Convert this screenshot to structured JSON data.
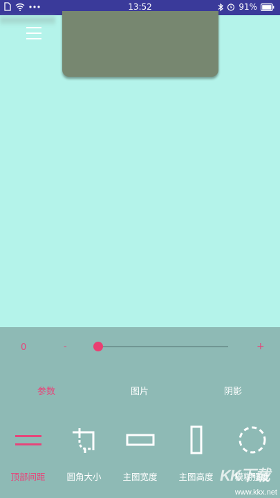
{
  "status_bar": {
    "time": "13:52",
    "battery_text": "91%",
    "icons": [
      "sim-icon",
      "wifi-icon",
      "more-dots-icon",
      "bluetooth-icon",
      "alarm-icon",
      "battery-icon"
    ]
  },
  "toolbar": {
    "menu_icon": "hamburger-menu-icon"
  },
  "preview": {
    "card_color": "#778770",
    "background_color": "#b4f3ea"
  },
  "slider": {
    "min_label": "0",
    "minus_label": "-",
    "plus_label": "+",
    "value_fraction": 0,
    "accent": "#ea3f72"
  },
  "tabs": [
    {
      "label": "参数",
      "active": true
    },
    {
      "label": "图片",
      "active": false
    },
    {
      "label": "阴影",
      "active": false
    }
  ],
  "tools": [
    {
      "label": "顶部间距",
      "icon": "top-spacing-icon",
      "active": true
    },
    {
      "label": "圆角大小",
      "icon": "corner-radius-icon",
      "active": false
    },
    {
      "label": "主图宽度",
      "icon": "width-icon",
      "active": false
    },
    {
      "label": "主图高度",
      "icon": "height-icon",
      "active": false
    },
    {
      "label": "模糊强度",
      "icon": "blur-icon",
      "active": false
    }
  ],
  "watermark": {
    "logo": "KK下载",
    "url": "www.kkx.net"
  },
  "colors": {
    "accent": "#e6457a",
    "panel": "#8ebab5",
    "status_bar": "#3a3a9a"
  }
}
